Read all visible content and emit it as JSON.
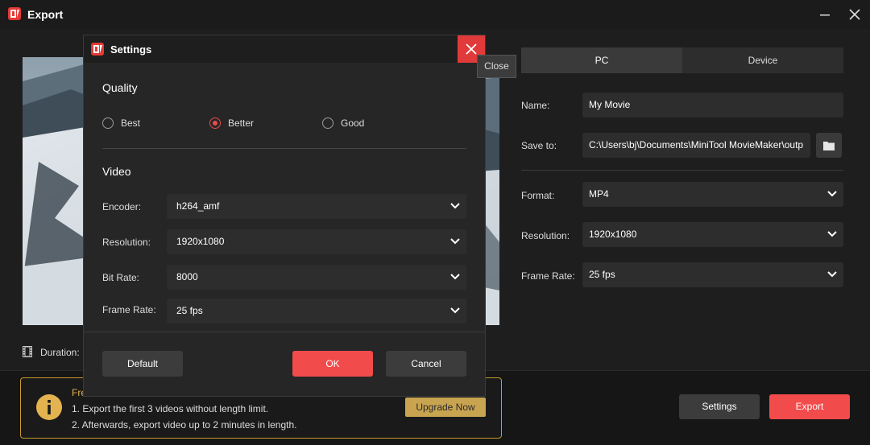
{
  "window": {
    "title": "Export",
    "minimize_symbol": "—",
    "close_symbol": "✕"
  },
  "preview": {
    "duration_label": "Duration:"
  },
  "tabs": [
    {
      "label": "PC",
      "active": true
    },
    {
      "label": "Device",
      "active": false
    }
  ],
  "form": {
    "name_label": "Name:",
    "name_value": "My Movie",
    "save_to_label": "Save to:",
    "save_to_value": "C:\\Users\\bj\\Documents\\MiniTool MovieMaker\\outp",
    "format_label": "Format:",
    "format_value": "MP4",
    "resolution_label": "Resolution:",
    "resolution_value": "1920x1080",
    "frame_rate_label": "Frame Rate:",
    "frame_rate_value": "25 fps"
  },
  "info": {
    "heading": "Fre",
    "line1": "1. Export the first 3 videos without length limit.",
    "line2": "2. Afterwards, export video up to 2 minutes in length.",
    "upgrade_label": "Upgrade Now"
  },
  "footer": {
    "settings_label": "Settings",
    "export_label": "Export"
  },
  "dialog": {
    "title": "Settings",
    "close_tooltip": "Close",
    "quality_title": "Quality",
    "quality_options": [
      {
        "label": "Best",
        "checked": false
      },
      {
        "label": "Better",
        "checked": true
      },
      {
        "label": "Good",
        "checked": false
      }
    ],
    "video_title": "Video",
    "encoder_label": "Encoder:",
    "encoder_value": "h264_amf",
    "resolution_label": "Resolution:",
    "resolution_value": "1920x1080",
    "bitrate_label": "Bit Rate:",
    "bitrate_value": "8000",
    "frame_rate_label": "Frame Rate:",
    "frame_rate_value": "25 fps",
    "default_label": "Default",
    "ok_label": "OK",
    "cancel_label": "Cancel"
  },
  "colors": {
    "accent": "#f24b4b",
    "info_border": "#c99a2e",
    "upgrade_bg": "#c9a450"
  },
  "icons": [
    "app-logo-icon",
    "minimize-icon",
    "close-icon",
    "film-icon",
    "folder-icon",
    "chevron-down-icon",
    "info-icon"
  ]
}
